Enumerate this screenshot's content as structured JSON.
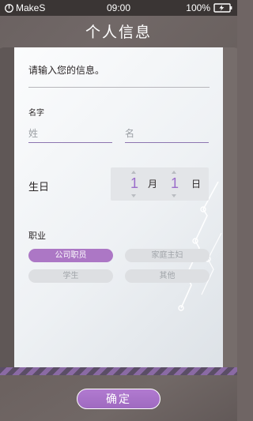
{
  "status_bar": {
    "brand": "MakeS",
    "time": "09:00",
    "battery": "100%"
  },
  "header": {
    "title": "个人信息"
  },
  "form": {
    "prompt": "请输入您的信息。",
    "name_label": "名字",
    "surname_placeholder": "姓",
    "given_name_placeholder": "名",
    "birthday_label": "生日",
    "birthday": {
      "month": "1",
      "month_unit": "月",
      "day": "1",
      "day_unit": "日"
    },
    "occupation_label": "职业",
    "occupations": [
      {
        "label": "公司职员",
        "selected": true
      },
      {
        "label": "家庭主妇",
        "selected": false
      },
      {
        "label": "学生",
        "selected": false
      },
      {
        "label": "其他",
        "selected": false
      }
    ]
  },
  "footer": {
    "confirm_label": "确定"
  },
  "colors": {
    "accent": "#ac77c5",
    "button": "#a56ec5",
    "panel_background": "#f3f5f7",
    "header_background": "#6f6564"
  },
  "icons": {
    "brand": "power-icon",
    "battery": "battery-charging-icon"
  }
}
